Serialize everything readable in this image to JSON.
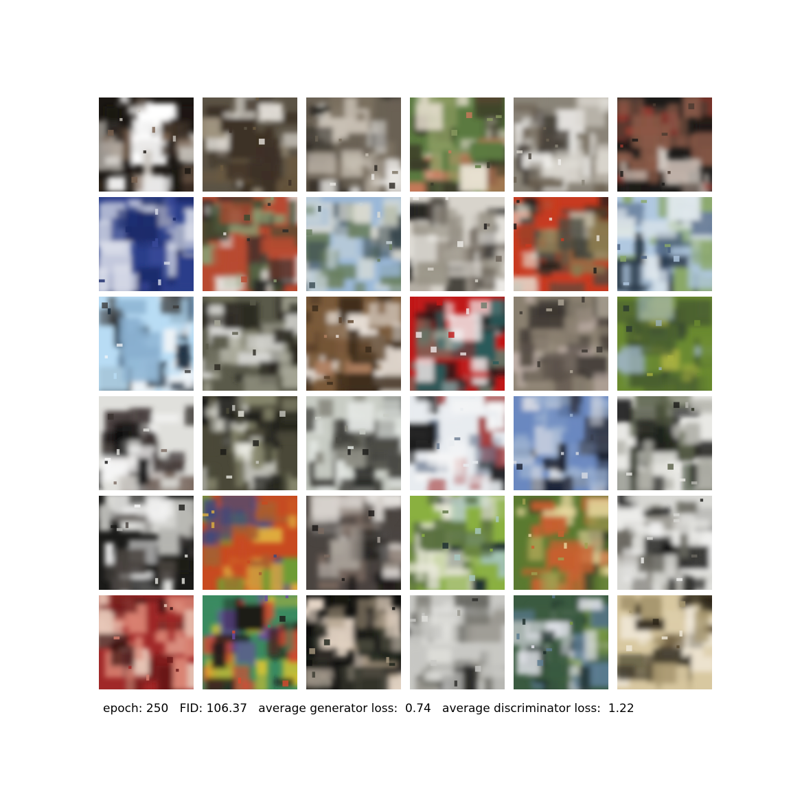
{
  "caption": "epoch: 250   FID: 106.37   average generator loss:  0.74   average discriminator loss:  1.22",
  "epoch": "250",
  "fid": "106.37",
  "avg_generator_loss": "0.74",
  "avg_discriminator_loss": "1.22",
  "grid_rows": 6,
  "grid_cols": 6,
  "samples": [
    {
      "palette": [
        "#1a1612",
        "#c9c4bd",
        "#7a6350",
        "#ffffff",
        "#3a2d22"
      ]
    },
    {
      "palette": [
        "#5b5345",
        "#9a8e7a",
        "#e8e4de",
        "#3c3025",
        "#6b5a40"
      ]
    },
    {
      "palette": [
        "#6a6154",
        "#c8c0b4",
        "#2a2722",
        "#e8e6e2",
        "#7b7060"
      ]
    },
    {
      "palette": [
        "#5b7a40",
        "#c9785a",
        "#3a3a28",
        "#e8e0d0",
        "#8a9a60"
      ]
    },
    {
      "palette": [
        "#8a8478",
        "#d8d4cc",
        "#4a443c",
        "#f0efec",
        "#6a6050"
      ]
    },
    {
      "palette": [
        "#1c1a18",
        "#8a5a48",
        "#d8d0c8",
        "#a03a30",
        "#4a3a30"
      ]
    },
    {
      "palette": [
        "#2a3e8a",
        "#d8dce8",
        "#3a4a9a",
        "#1a2a6a",
        "#8a90b0"
      ]
    },
    {
      "palette": [
        "#b84a30",
        "#e8e4e0",
        "#3a4a30",
        "#2a2a28",
        "#8a9a70"
      ]
    },
    {
      "palette": [
        "#9ab8d8",
        "#c8d4d8",
        "#6a8060",
        "#3a4a50",
        "#dcdcd4"
      ]
    },
    {
      "palette": [
        "#d8d4cc",
        "#6a6258",
        "#1a1816",
        "#eeece8",
        "#9a9488"
      ]
    },
    {
      "palette": [
        "#c83a20",
        "#4a4a40",
        "#e8e4d8",
        "#1a1a18",
        "#8a7a50"
      ]
    },
    {
      "palette": [
        "#b0c8e0",
        "#2a3a4a",
        "#8aa868",
        "#e0e8ec",
        "#4a6080"
      ]
    },
    {
      "palette": [
        "#b8dcf4",
        "#f0f4f8",
        "#3a3a3a",
        "#8ab0d0",
        "#1a2a3a"
      ]
    },
    {
      "palette": [
        "#5a5a4a",
        "#d8d8d4",
        "#2a2820",
        "#a8a898",
        "#7a7a60"
      ]
    },
    {
      "palette": [
        "#7a5a3a",
        "#e8e0d8",
        "#3a2a1a",
        "#b08060",
        "#5a4028"
      ]
    },
    {
      "palette": [
        "#c01818",
        "#2a5a5a",
        "#f0e8e8",
        "#1a1a1a",
        "#6a7a6a"
      ]
    },
    {
      "palette": [
        "#8a8070",
        "#3a3430",
        "#b0a898",
        "#5a5048",
        "#c0b0a8"
      ]
    },
    {
      "palette": [
        "#6a8a30",
        "#a8b040",
        "#4a6030",
        "#2a3a30",
        "#9ab0b8"
      ]
    },
    {
      "palette": [
        "#e0e0dc",
        "#3a3230",
        "#f8f8f8",
        "#7a6a60",
        "#101010"
      ]
    },
    {
      "palette": [
        "#4a4838",
        "#c8c8c0",
        "#1a1a16",
        "#8a8a70",
        "#e8e8e0"
      ]
    },
    {
      "palette": [
        "#c8ccc4",
        "#4a4a44",
        "#e4e8e4",
        "#1a1a18",
        "#8a8a80"
      ]
    },
    {
      "palette": [
        "#e8ecf0",
        "#a03030",
        "#1a1a1a",
        "#6a7a90",
        "#f8f8f8"
      ]
    },
    {
      "palette": [
        "#6a88c0",
        "#1a2030",
        "#d8dce4",
        "#3a4050",
        "#9ab0d0"
      ]
    },
    {
      "palette": [
        "#e8e8e4",
        "#1a1a18",
        "#5a6048",
        "#b8b8b0",
        "#2a3020"
      ]
    },
    {
      "palette": [
        "#1a1a18",
        "#e8e8e4",
        "#b8b8b4",
        "#4a4440",
        "#fafafa"
      ]
    },
    {
      "palette": [
        "#c84a20",
        "#70a030",
        "#e0b040",
        "#3a4a80",
        "#a86030"
      ]
    },
    {
      "palette": [
        "#4a4440",
        "#a8a098",
        "#e8e4e0",
        "#1a1816",
        "#7a6a60"
      ]
    },
    {
      "palette": [
        "#8ab040",
        "#5a7040",
        "#e8e8d8",
        "#1a2a30",
        "#a8c8c0"
      ]
    },
    {
      "palette": [
        "#5a7a30",
        "#c86030",
        "#2a3020",
        "#a0a050",
        "#e8d8a0"
      ]
    },
    {
      "palette": [
        "#d8d8d4",
        "#1a1a18",
        "#6a6860",
        "#f0f0ee",
        "#9a9890"
      ]
    },
    {
      "palette": [
        "#a02828",
        "#e8c8b8",
        "#6a1818",
        "#d88070",
        "#3a1010"
      ]
    },
    {
      "palette": [
        "#3a8a60",
        "#d84a30",
        "#e0c830",
        "#6a4aa0",
        "#1a1a18"
      ]
    },
    {
      "palette": [
        "#0e0e0c",
        "#3a3a30",
        "#a89880",
        "#1a2018",
        "#e8d8c8"
      ]
    },
    {
      "palette": [
        "#c8c8c4",
        "#6a6a64",
        "#e0e0dc",
        "#2a2a28",
        "#9a9890"
      ]
    },
    {
      "palette": [
        "#3a5a40",
        "#7a9a40",
        "#e8e8f0",
        "#1a2a28",
        "#5a7a90"
      ]
    },
    {
      "palette": [
        "#d8c8a0",
        "#2a2418",
        "#a89870",
        "#f0e8d8",
        "#5a4a30"
      ]
    }
  ]
}
